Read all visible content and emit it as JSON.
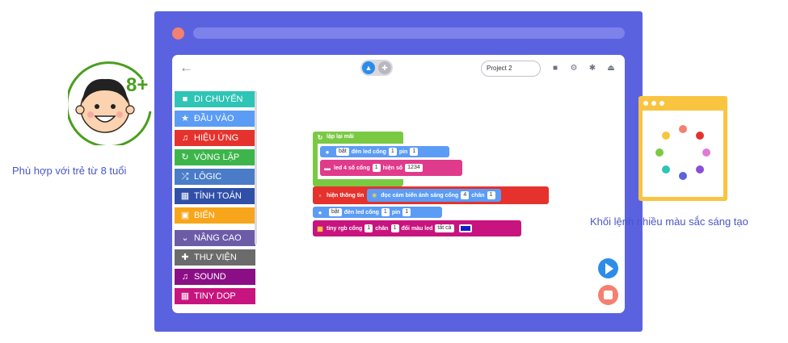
{
  "toolbar": {
    "project_name": "Project 2"
  },
  "categories": [
    {
      "label": "DI CHUYỂN",
      "color": "#2ec4b6",
      "icon": "car-icon"
    },
    {
      "label": "ĐẦU VÀO",
      "color": "#5b9cf5",
      "icon": "star-icon"
    },
    {
      "label": "HIỆU ỨNG",
      "color": "#e5322d",
      "icon": "music-icon"
    },
    {
      "label": "VÒNG LẶP",
      "color": "#3db54a",
      "icon": "loop-icon"
    },
    {
      "label": "LÔGIC",
      "color": "#4a7cc7",
      "icon": "shuffle-icon"
    },
    {
      "label": "TÍNH TOÁN",
      "color": "#3050a8",
      "icon": "calculator-icon"
    },
    {
      "label": "BIẾN",
      "color": "#f7a61b",
      "icon": "save-icon"
    },
    {
      "label": "NÂNG CAO",
      "color": "#6c5ca8",
      "icon": "chevron-down-icon"
    },
    {
      "label": "THƯ VIỆN",
      "color": "#6b6b6b",
      "icon": "plus-icon"
    },
    {
      "label": "SOUND",
      "color": "#8a0f86",
      "icon": "music-icon"
    },
    {
      "label": "TINY DOP",
      "color": "#c8147e",
      "icon": "grid-icon"
    }
  ],
  "blocks": {
    "loop": {
      "label": "lặp lại mãi",
      "color": "#7ac943"
    },
    "led_on_1": {
      "label": "bật",
      "text1": "đèn led cổng",
      "port": "1",
      "text2": "pin",
      "pin": "1",
      "color": "#5b9cf5"
    },
    "led4": {
      "label": "led 4 số cổng",
      "port": "1",
      "text": "hiện số",
      "value": "1234",
      "color": "#e03a8c"
    },
    "show_info": {
      "label": "hiện thông tin",
      "color": "#e5322d"
    },
    "light_sensor": {
      "label": "đọc cảm biến ánh sáng cổng",
      "port": "4",
      "text": "chân",
      "pin": "1",
      "color": "#5b9cf5"
    },
    "led_on_2": {
      "label": "bật",
      "text1": "đèn led cổng",
      "port": "1",
      "text2": "pin",
      "pin": "1",
      "color": "#5b9cf5"
    },
    "tiny_rgb": {
      "label": "tiny rgb cổng",
      "port": "1",
      "text1": "chân",
      "pin": "1",
      "text2": "đổi màu led",
      "mode": "tất cả",
      "led_color": "#1020c8",
      "color": "#c8147e"
    }
  },
  "badges": {
    "age_label": "8+",
    "age_text": "Phù hợp với trẻ từ 8 tuổi",
    "color_text": "Khối lệnh nhiều màu sắc sáng tạo"
  },
  "colors": {
    "frame": "#5b62e0",
    "accent_blue": "#2c8de8",
    "stop_red": "#f4806f",
    "badge_green": "#4a9e1e",
    "window_yellow": "#f9c440"
  }
}
